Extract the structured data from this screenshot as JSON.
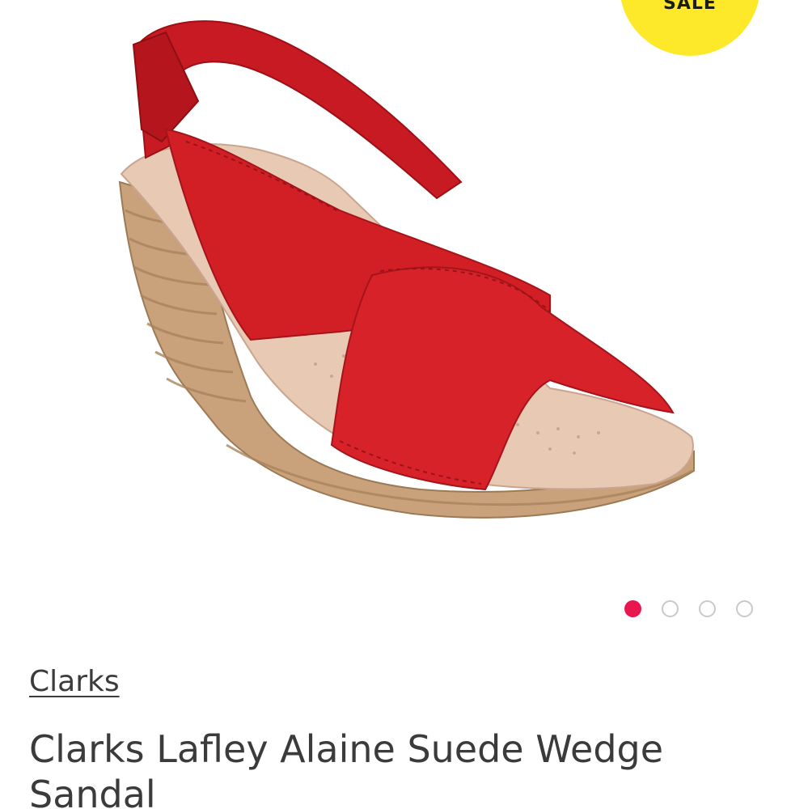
{
  "badge": {
    "label": "SALE",
    "color": "#fde82a"
  },
  "gallery": {
    "image_alt": "Red suede cross-strap wedge sandal with espadrille heel",
    "total_images": 4,
    "active_index": 0,
    "active_dot_color": "#e8184f"
  },
  "product": {
    "brand": "Clarks",
    "title": "Clarks Lafley Alaine Suede Wedge Sandal"
  }
}
